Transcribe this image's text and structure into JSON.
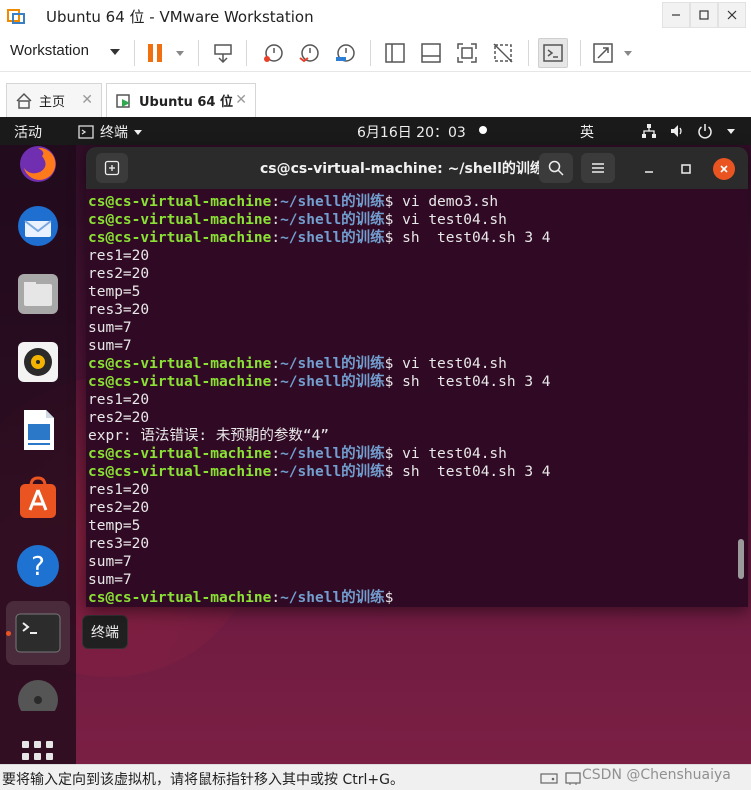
{
  "window": {
    "title": "Ubuntu 64 位 - VMware Workstation"
  },
  "toolbar": {
    "workstation_menu": "Workstation"
  },
  "tabs": [
    {
      "label": "主页"
    },
    {
      "label": "Ubuntu 64 位"
    }
  ],
  "ubuntu": {
    "topbar": {
      "activities": "活动",
      "app_name": "终端",
      "clock": "6月16日  20：03",
      "ime": "英"
    },
    "dock_tooltip": "终端"
  },
  "terminal": {
    "title": "cs@cs-virtual-machine: ~/shell的训练",
    "prompt_user": "cs@cs-virtual-machine",
    "prompt_sep": ":",
    "prompt_path": "~/shell的训练",
    "prompt_symbol": "$",
    "lines": [
      {
        "kind": "cmd",
        "text": " vi demo3.sh"
      },
      {
        "kind": "cmd",
        "text": " vi test04.sh"
      },
      {
        "kind": "cmd",
        "text": " sh  test04.sh 3 4"
      },
      {
        "kind": "out",
        "text": "res1=20"
      },
      {
        "kind": "out",
        "text": "res2=20"
      },
      {
        "kind": "out",
        "text": "temp=5"
      },
      {
        "kind": "out",
        "text": "res3=20"
      },
      {
        "kind": "out",
        "text": "sum=7"
      },
      {
        "kind": "out",
        "text": "sum=7"
      },
      {
        "kind": "cmd",
        "text": " vi test04.sh"
      },
      {
        "kind": "cmd",
        "text": " sh  test04.sh 3 4"
      },
      {
        "kind": "out",
        "text": "res1=20"
      },
      {
        "kind": "out",
        "text": "res2=20"
      },
      {
        "kind": "out",
        "text": "expr: 语法错误: 未预期的参数“4”"
      },
      {
        "kind": "cmd",
        "text": " vi test04.sh"
      },
      {
        "kind": "cmd",
        "text": " sh  test04.sh 3 4"
      },
      {
        "kind": "out",
        "text": "res1=20"
      },
      {
        "kind": "out",
        "text": "res2=20"
      },
      {
        "kind": "out",
        "text": "temp=5"
      },
      {
        "kind": "out",
        "text": "res3=20"
      },
      {
        "kind": "out",
        "text": "sum=7"
      },
      {
        "kind": "out",
        "text": "sum=7"
      },
      {
        "kind": "cmd",
        "text": ""
      }
    ]
  },
  "statusbar": {
    "message": "要将输入定向到该虚拟机，请将鼠标指针移入其中或按 Ctrl+G。",
    "watermark": "CSDN @Chenshuaiya"
  },
  "colors": {
    "prompt_user": "#8ae234",
    "prompt_path": "#729fcf",
    "terminal_bg": "#300a24",
    "close_button": "#e95420"
  }
}
